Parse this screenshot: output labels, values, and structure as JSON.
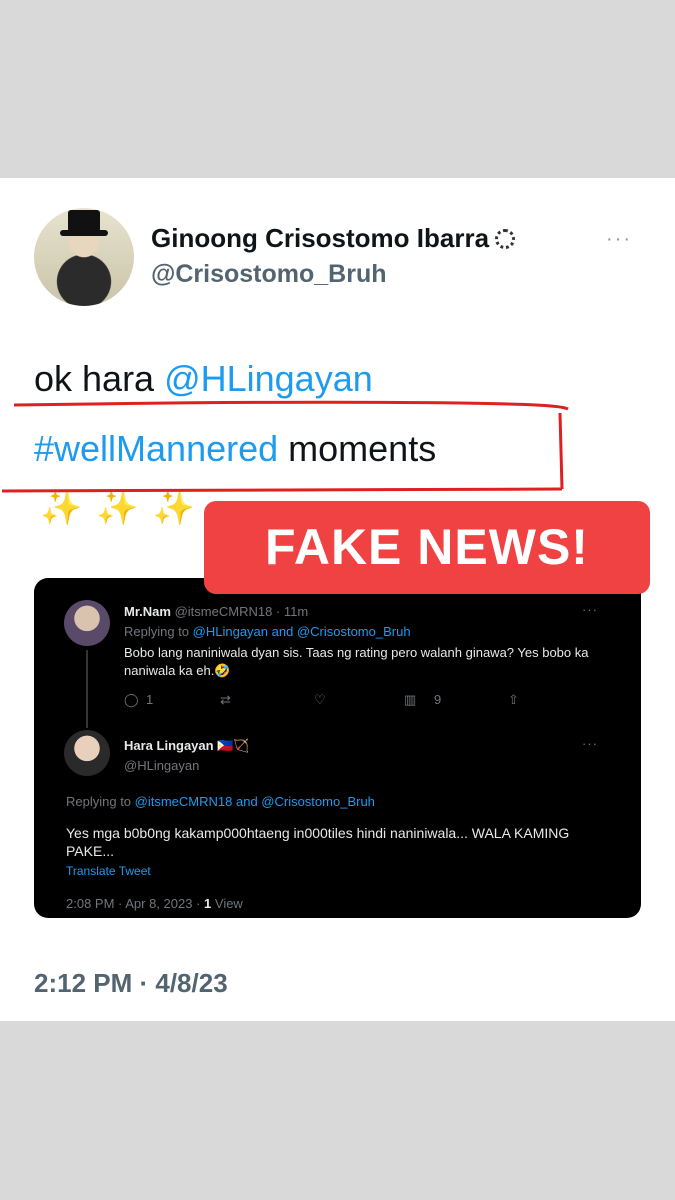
{
  "tweet": {
    "author_name": "Ginoong Crisostomo Ibarra",
    "author_handle": "@Crisostomo_Bruh",
    "more": "···",
    "text_line1_prefix": "ok hara ",
    "text_mention": "@HLingayan",
    "text_hashtag": "#wellMannered",
    "text_line2_suffix": " moments",
    "sparkles": "✨✨✨",
    "timestamp": "2:12 PM · 4/8/23"
  },
  "overlay": {
    "label": "FAKE NEWS!"
  },
  "embed": {
    "reply1": {
      "name": "Mr.Nam",
      "handle": "@itsmeCMRN18 · 11m",
      "replying_prefix": "Replying to ",
      "replying_links": "@HLingayan and @Crisostomo_Bruh",
      "body": "Bobo lang naniniwala dyan sis. Taas ng rating pero walanh ginawa? Yes bobo ka naniwala ka eh.🤣",
      "reply_count": "1",
      "views_count": "9"
    },
    "reply2": {
      "name": "Hara Lingayan 🇵🇭🏹",
      "handle": "@HLingayan",
      "replying_prefix": "Replying to ",
      "replying_links": "@itsmeCMRN18 and @Crisostomo_Bruh",
      "body": "Yes mga b0b0ng kakamp000htaeng in000tiles hindi naniniwala... WALA KAMING PAKE...",
      "translate": "Translate Tweet",
      "meta_prefix": "2:08 PM · Apr 8, 2023 · ",
      "views": "1",
      "views_suffix": " View"
    },
    "more": "···"
  },
  "colors": {
    "link": "#1d9bf0",
    "badge": "#f04242",
    "annotation": "#e02020"
  }
}
